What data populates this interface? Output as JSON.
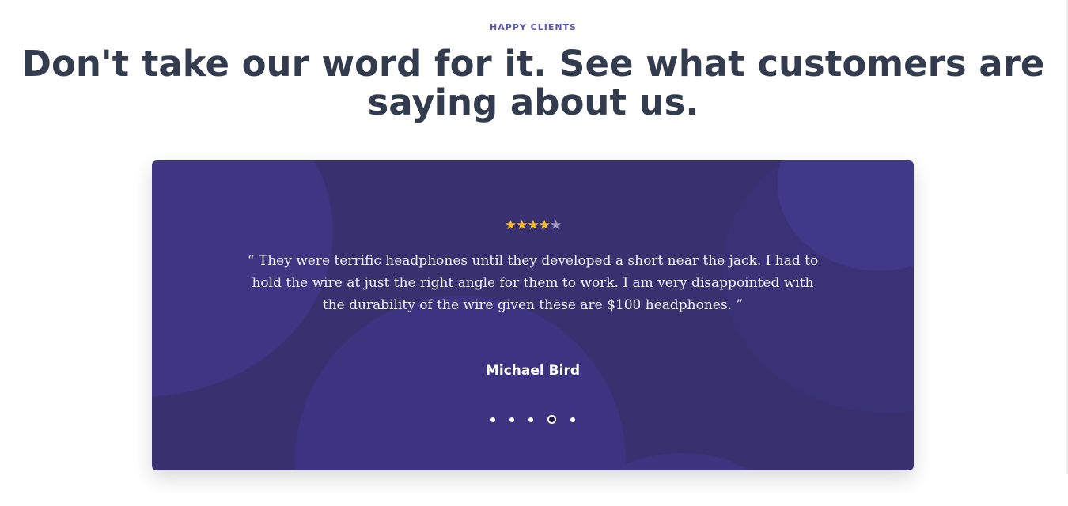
{
  "section": {
    "eyebrow": "HAPPY CLIENTS",
    "title": "Don't take our word for it. See what customers are saying about us."
  },
  "testimonial": {
    "rating": 4,
    "max_rating": 5,
    "quote": "“ They were terrific headphones until they developed a short near the jack. I had to hold the wire at just the right angle for them to work. I am very disappointed with the durability of the wire given these are $100 headphones. ”",
    "author": "Michael Bird",
    "slides": 5,
    "active_slide": 4
  },
  "colors": {
    "card_bg": "#38306f",
    "star": "#f6bd2c",
    "eyebrow": "#5a58b0",
    "title": "#333c4e"
  }
}
